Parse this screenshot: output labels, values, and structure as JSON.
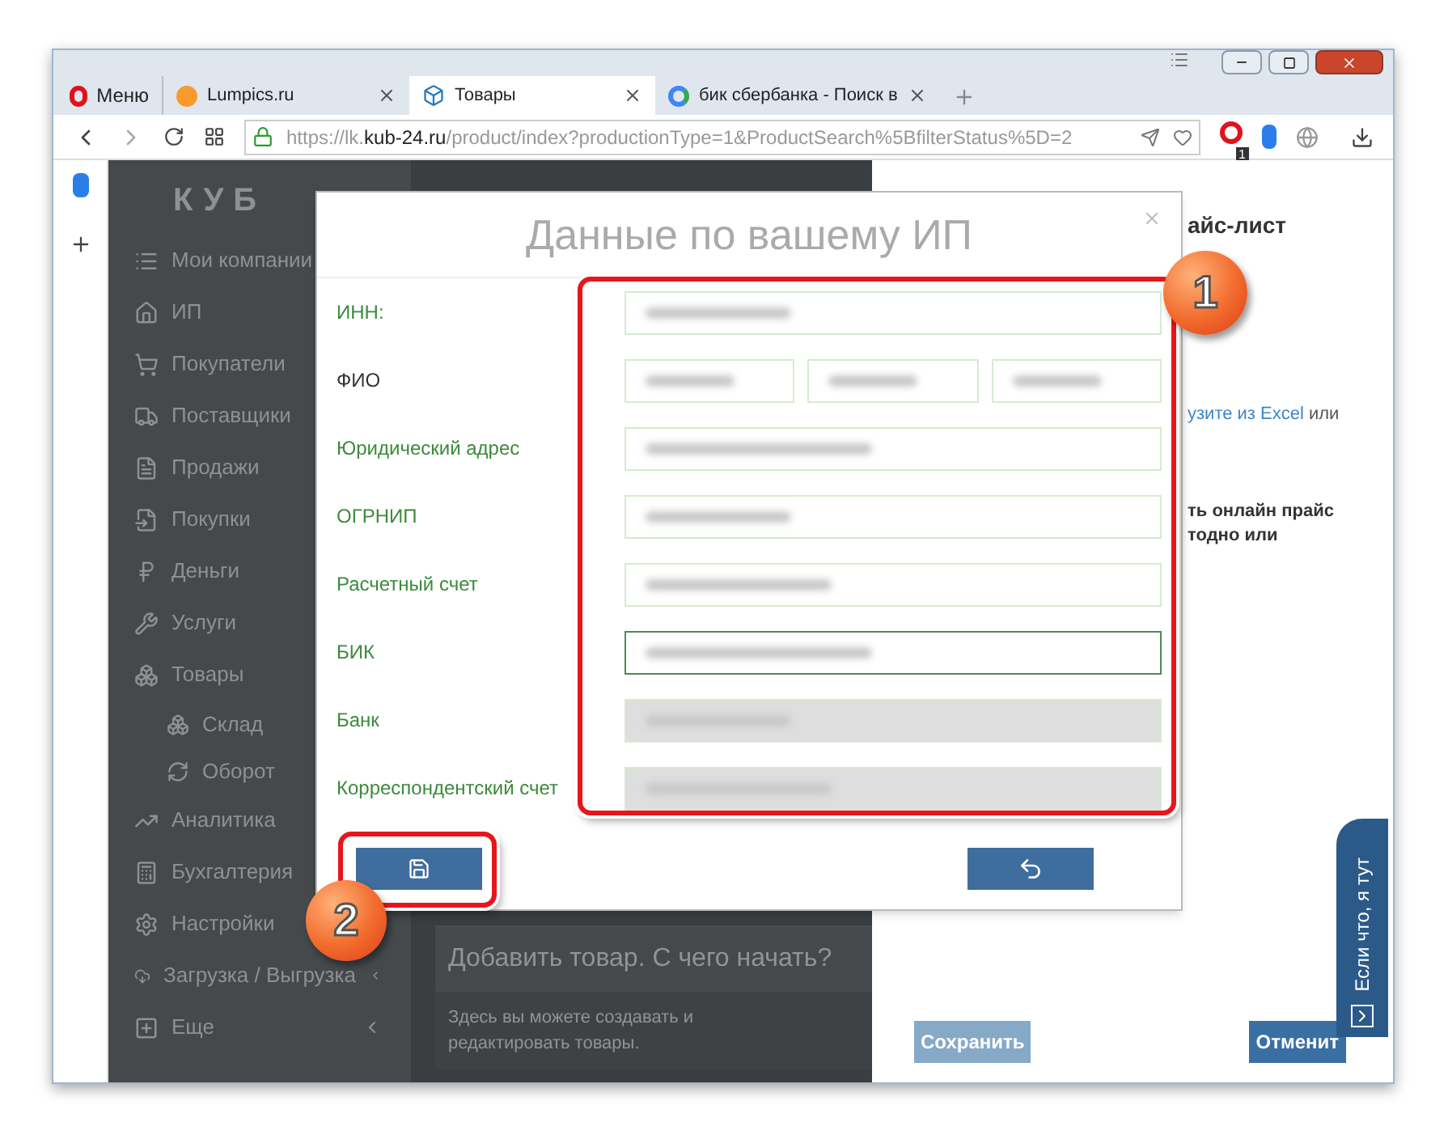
{
  "browser": {
    "tabs": [
      {
        "label": "Меню",
        "kind": "menu",
        "selected": false
      },
      {
        "label": "Lumpics.ru",
        "kind": "tab",
        "selected": false
      },
      {
        "label": "Товары",
        "kind": "tab",
        "selected": true
      },
      {
        "label": "бик сбербанка - Поиск в",
        "kind": "tab",
        "selected": false
      }
    ],
    "url": {
      "scheme": "https://lk.",
      "host": "kub-24.ru",
      "path": "/product/index?productionType=1&ProductSearch%5BfilterStatus%5D=2"
    },
    "extension_badge": "1"
  },
  "sidebar": {
    "logo": "КУБ",
    "items": [
      {
        "label": "Мои компании"
      },
      {
        "label": "ИП"
      },
      {
        "label": "Покупатели"
      },
      {
        "label": "Поставщики"
      },
      {
        "label": "Продажи"
      },
      {
        "label": "Покупки"
      },
      {
        "label": "Деньги"
      },
      {
        "label": "Услуги"
      },
      {
        "label": "Товары",
        "children": [
          {
            "label": "Склад"
          },
          {
            "label": "Оборот"
          }
        ]
      },
      {
        "label": "Аналитика"
      },
      {
        "label": "Бухгалтерия"
      },
      {
        "label": "Настройки"
      },
      {
        "label": "Загрузка / Выгрузка",
        "expandable": true
      },
      {
        "label": "Еще",
        "expandable": true
      }
    ]
  },
  "main": {
    "card_title": "Добавить товар. С чего начать?",
    "card_text": "Здесь вы можете создавать и редактировать товары."
  },
  "right_panel": {
    "heading": "айс-лист",
    "link": "узите из Excel",
    "link_rest": "или",
    "bold_lines": [
      "ть онлайн прайс",
      "тодно или"
    ],
    "buttons": [
      {
        "label": "Сохранить",
        "disabled": true
      },
      {
        "label": "Отменит",
        "disabled": false
      }
    ]
  },
  "help_tab": "Если что, я тут",
  "modal": {
    "title": "Данные по вашему ИП",
    "fields": [
      {
        "label": "ИНН:",
        "kind": "single",
        "valid": true,
        "focused": false,
        "disabled": false
      },
      {
        "label": "ФИО",
        "kind": "triple",
        "valid": false,
        "focused": false,
        "disabled": false
      },
      {
        "label": "Юридический адрес",
        "kind": "single",
        "valid": true,
        "focused": false,
        "disabled": false
      },
      {
        "label": "ОГРНИП",
        "kind": "single",
        "valid": true,
        "focused": false,
        "disabled": false
      },
      {
        "label": "Расчетный счет",
        "kind": "single",
        "valid": true,
        "focused": false,
        "disabled": false
      },
      {
        "label": "БИК",
        "kind": "single",
        "valid": true,
        "focused": true,
        "disabled": false
      },
      {
        "label": "Банк",
        "kind": "single",
        "valid": true,
        "focused": false,
        "disabled": true
      },
      {
        "label": "Корреспондентский счет",
        "kind": "single",
        "valid": true,
        "focused": false,
        "disabled": true
      }
    ]
  },
  "annotations": [
    {
      "label": "1"
    },
    {
      "label": "2"
    }
  ]
}
